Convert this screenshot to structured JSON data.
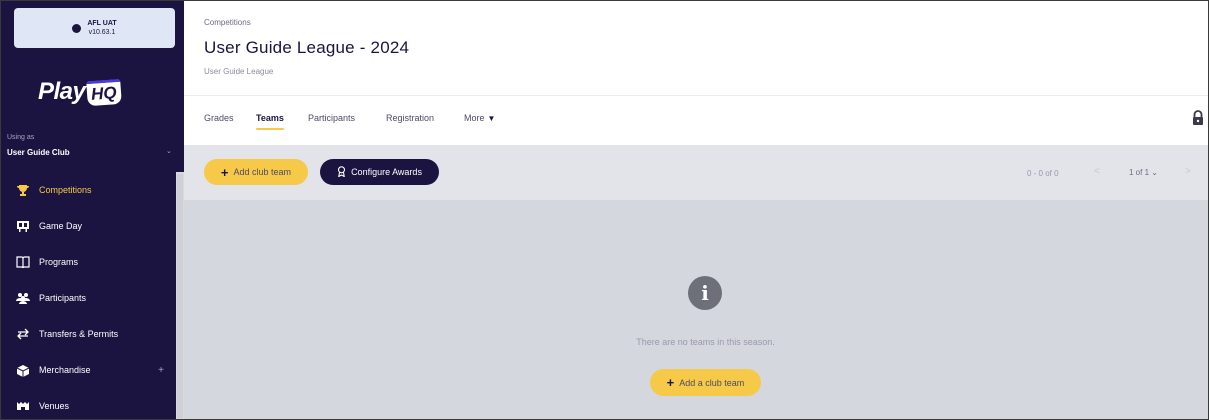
{
  "environment": {
    "name": "AFL UAT",
    "version": "v10.63.1"
  },
  "brand": {
    "logo_text": "Play",
    "logo_badge": "HQ"
  },
  "user": {
    "using_as_label": "Using as",
    "club_name": "User Guide Club"
  },
  "sidebar": {
    "items": [
      {
        "label": "Competitions",
        "icon": "trophy-icon",
        "active": true
      },
      {
        "label": "Game Day",
        "icon": "scoreboard-icon",
        "active": false
      },
      {
        "label": "Programs",
        "icon": "book-icon",
        "active": false
      },
      {
        "label": "Participants",
        "icon": "people-icon",
        "active": false
      },
      {
        "label": "Transfers & Permits",
        "icon": "transfer-arrows-icon",
        "active": false
      },
      {
        "label": "Merchandise",
        "icon": "box-icon",
        "active": false,
        "expandable": true
      },
      {
        "label": "Venues",
        "icon": "stadium-icon",
        "active": false
      }
    ]
  },
  "header": {
    "breadcrumb": "Competitions",
    "title": "User Guide League - 2024",
    "subtitle": "User Guide League"
  },
  "tabs": [
    {
      "label": "Grades",
      "active": false
    },
    {
      "label": "Teams",
      "active": true
    },
    {
      "label": "Participants",
      "active": false
    },
    {
      "label": "Registration",
      "active": false
    },
    {
      "label": "More",
      "active": false
    }
  ],
  "toolbar": {
    "add_club_team_label": "Add club team",
    "configure_awards_label": "Configure Awards"
  },
  "pagination": {
    "range": "0 - 0 of 0",
    "page": "1 of 1"
  },
  "empty_state": {
    "message": "There are no teams in this season.",
    "button_label": "Add a club team"
  },
  "colors": {
    "sidebar_bg": "#1b1440",
    "accent": "#f7c948",
    "content_bg": "#d4d7de"
  }
}
